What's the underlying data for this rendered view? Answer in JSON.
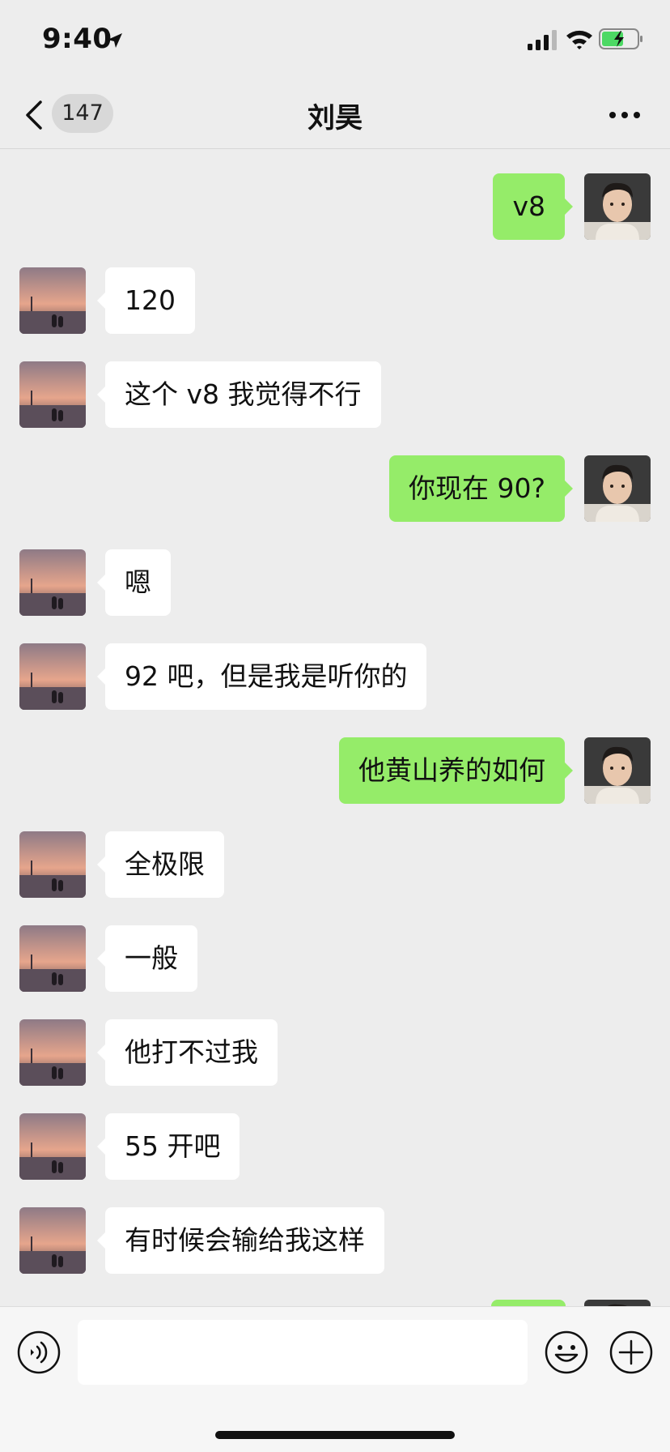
{
  "status_bar": {
    "time": "9:40",
    "location_icon": "location-arrow-icon",
    "signal_icon": "cellular-signal-icon",
    "wifi_icon": "wifi-icon",
    "battery_icon": "battery-charging-icon",
    "battery_color": "#4cd964"
  },
  "nav": {
    "back_icon": "chevron-left-icon",
    "unread_count": "147",
    "title": "刘昊",
    "more_icon": "more-dots-icon"
  },
  "messages": [
    {
      "side": "right",
      "text": "v8"
    },
    {
      "side": "left",
      "text": "120"
    },
    {
      "side": "left",
      "text": "这个 v8 我觉得不行"
    },
    {
      "side": "right",
      "text": "你现在 90?"
    },
    {
      "side": "left",
      "text": "嗯"
    },
    {
      "side": "left",
      "text": "92 吧，但是我是听你的"
    },
    {
      "side": "right",
      "text": "他黄山养的如何"
    },
    {
      "side": "left",
      "text": "全极限"
    },
    {
      "side": "left",
      "text": "一般"
    },
    {
      "side": "left",
      "text": "他打不过我"
    },
    {
      "side": "left",
      "text": "55 开吧"
    },
    {
      "side": "left",
      "text": "有时候会输给我这样"
    }
  ],
  "input_bar": {
    "voice_icon": "voice-input-icon",
    "text_value": "",
    "emoji_icon": "emoji-icon",
    "plus_icon": "plus-circle-icon"
  },
  "colors": {
    "background": "#ededed",
    "sent_bubble": "#95ec69",
    "received_bubble": "#ffffff"
  }
}
